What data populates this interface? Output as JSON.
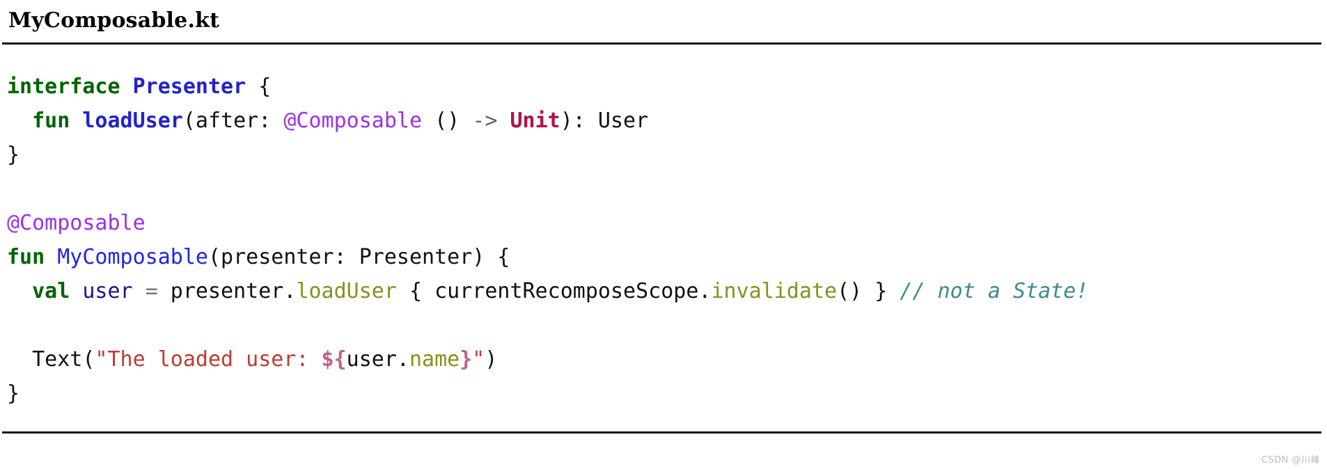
{
  "file": {
    "title": "MyComposable.kt"
  },
  "code": {
    "language": "kotlin",
    "lines": [
      {
        "index": 1,
        "text": "interface Presenter {",
        "tokens": [
          {
            "t": "interface",
            "c": "kw"
          },
          {
            "t": " ",
            "c": "plain"
          },
          {
            "t": "Presenter",
            "c": "fn-b"
          },
          {
            "t": " {",
            "c": "plain"
          }
        ]
      },
      {
        "index": 2,
        "text": "  fun loadUser(after: @Composable () -> Unit): User",
        "tokens": [
          {
            "t": "  ",
            "c": "plain"
          },
          {
            "t": "fun",
            "c": "kw"
          },
          {
            "t": " ",
            "c": "plain"
          },
          {
            "t": "loadUser",
            "c": "fn-b"
          },
          {
            "t": "(after: ",
            "c": "plain"
          },
          {
            "t": "@Composable",
            "c": "anno"
          },
          {
            "t": " () ",
            "c": "plain"
          },
          {
            "t": "->",
            "c": "arrow"
          },
          {
            "t": " ",
            "c": "plain"
          },
          {
            "t": "Unit",
            "c": "type-r"
          },
          {
            "t": "): User",
            "c": "plain"
          }
        ]
      },
      {
        "index": 3,
        "text": "}",
        "tokens": [
          {
            "t": "}",
            "c": "plain"
          }
        ]
      },
      {
        "index": 4,
        "text": "",
        "tokens": []
      },
      {
        "index": 5,
        "text": "@Composable",
        "tokens": [
          {
            "t": "@Composable",
            "c": "anno"
          }
        ]
      },
      {
        "index": 6,
        "text": "fun MyComposable(presenter: Presenter) {",
        "tokens": [
          {
            "t": "fun",
            "c": "kw"
          },
          {
            "t": " ",
            "c": "plain"
          },
          {
            "t": "MyComposable",
            "c": "fn"
          },
          {
            "t": "(presenter: Presenter) {",
            "c": "plain"
          }
        ]
      },
      {
        "index": 7,
        "text": "  val user = presenter.loadUser { currentRecomposeScope.invalidate() } // not a State!",
        "tokens": [
          {
            "t": "  ",
            "c": "plain"
          },
          {
            "t": "val",
            "c": "kw"
          },
          {
            "t": " ",
            "c": "plain"
          },
          {
            "t": "user",
            "c": "local"
          },
          {
            "t": " ",
            "c": "plain"
          },
          {
            "t": "=",
            "c": "op"
          },
          {
            "t": " presenter.",
            "c": "plain"
          },
          {
            "t": "loadUser",
            "c": "prop"
          },
          {
            "t": " { currentRecomposeScope.",
            "c": "plain"
          },
          {
            "t": "invalidate",
            "c": "prop"
          },
          {
            "t": "() } ",
            "c": "plain"
          },
          {
            "t": "// not a State!",
            "c": "cmt"
          }
        ]
      },
      {
        "index": 8,
        "text": "",
        "tokens": []
      },
      {
        "index": 9,
        "text": "  Text(\"The loaded user: ${user.name}\")",
        "tokens": [
          {
            "t": "  Text(",
            "c": "plain"
          },
          {
            "t": "\"The loaded user: ",
            "c": "str"
          },
          {
            "t": "${",
            "c": "tmpl"
          },
          {
            "t": "user.",
            "c": "plain"
          },
          {
            "t": "name",
            "c": "prop"
          },
          {
            "t": "}",
            "c": "tmpl"
          },
          {
            "t": "\"",
            "c": "str"
          },
          {
            "t": ")",
            "c": "plain"
          }
        ]
      },
      {
        "index": 10,
        "text": "}",
        "tokens": [
          {
            "t": "}",
            "c": "plain"
          }
        ]
      }
    ]
  },
  "watermark": {
    "text": "CSDN @川峰"
  },
  "colors": {
    "keyword": "#006400",
    "declaration": "#2222CC",
    "annotation": "#9B30E8",
    "type_unit": "#B01050",
    "arrow": "#5A6472",
    "local_var": "#18188C",
    "property": "#88901E",
    "string": "#BE3A32",
    "template": "#C0618A",
    "comment": "#3D8A91",
    "background": "#FFFFFF",
    "text": "#111111"
  }
}
